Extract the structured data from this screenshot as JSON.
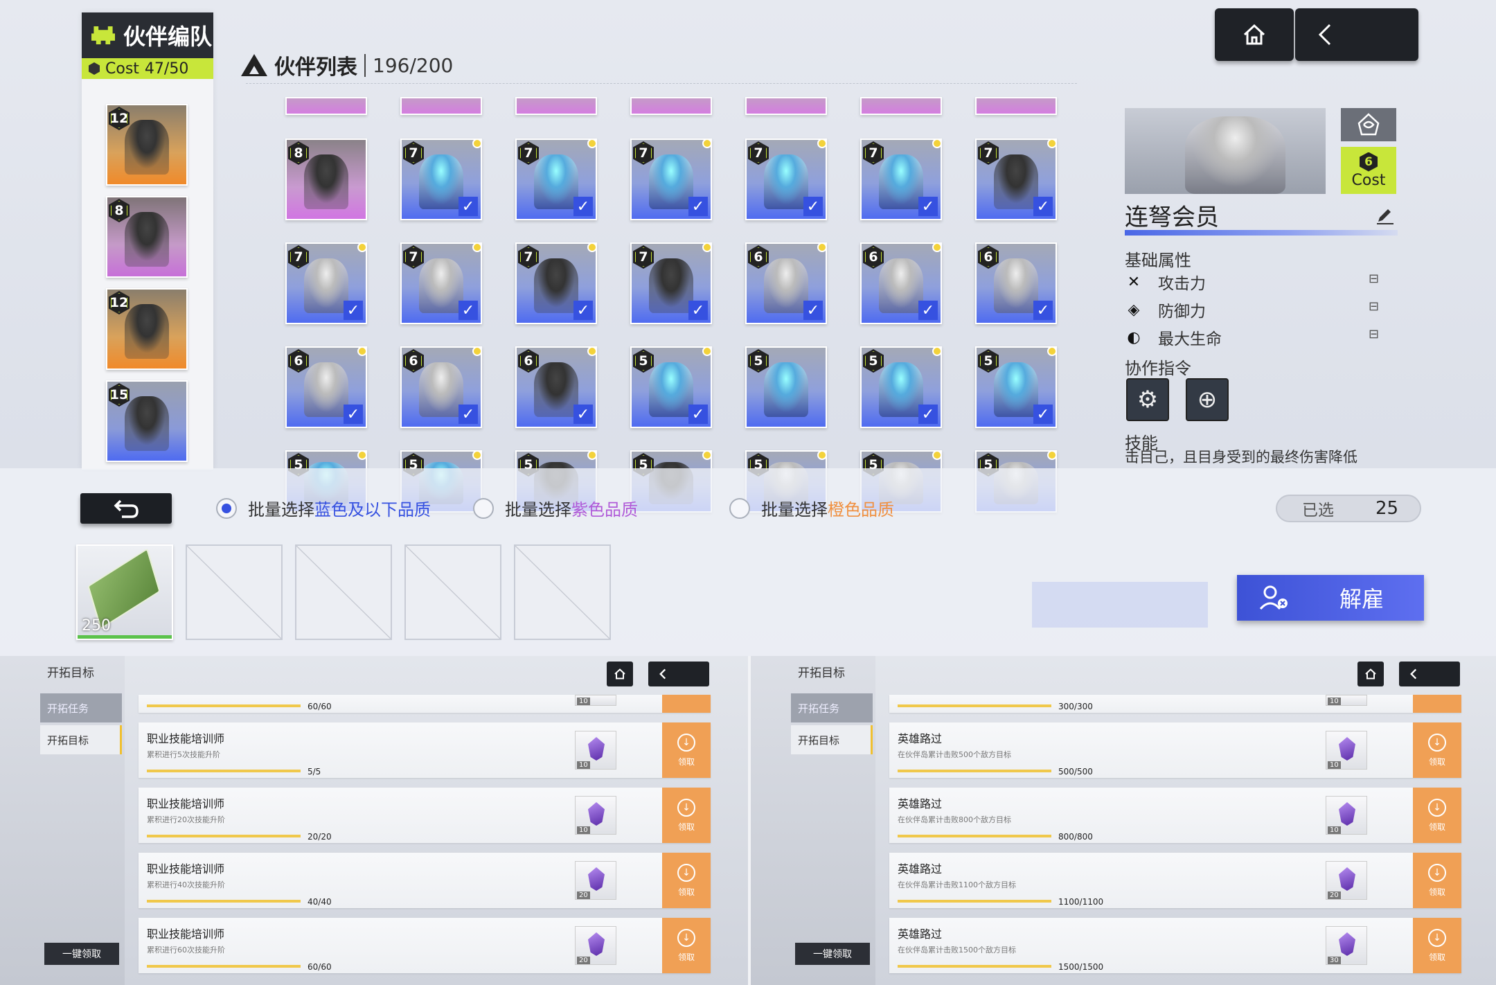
{
  "team": {
    "title": "伙伴编队",
    "cost_label": "Cost",
    "cost_value": "47/50",
    "slots": [
      {
        "level": "12",
        "rarity": "orange"
      },
      {
        "level": "8",
        "rarity": "purple"
      },
      {
        "level": "12",
        "rarity": "orange"
      },
      {
        "level": "15",
        "rarity": "blue"
      }
    ]
  },
  "list": {
    "title": "伙伴列表",
    "count": "196/200",
    "rows": [
      [
        {
          "level": "8",
          "rarity": "purple",
          "checked": false,
          "dot": false
        },
        {
          "level": "7",
          "rarity": "blue",
          "checked": true,
          "dot": true
        },
        {
          "level": "7",
          "rarity": "blue",
          "checked": true,
          "dot": true
        },
        {
          "level": "7",
          "rarity": "blue",
          "checked": true,
          "dot": true
        },
        {
          "level": "7",
          "rarity": "blue",
          "checked": true,
          "dot": true
        },
        {
          "level": "7",
          "rarity": "blue",
          "checked": true,
          "dot": true
        },
        {
          "level": "7",
          "rarity": "blue",
          "checked": true,
          "dot": true
        }
      ],
      [
        {
          "level": "7",
          "rarity": "blue",
          "checked": true,
          "dot": true
        },
        {
          "level": "7",
          "rarity": "blue",
          "checked": true,
          "dot": true
        },
        {
          "level": "7",
          "rarity": "blue",
          "checked": true,
          "dot": true
        },
        {
          "level": "7",
          "rarity": "blue",
          "checked": true,
          "dot": true
        },
        {
          "level": "6",
          "rarity": "blue",
          "checked": true,
          "dot": true
        },
        {
          "level": "6",
          "rarity": "blue",
          "checked": true,
          "dot": true
        },
        {
          "level": "6",
          "rarity": "blue",
          "checked": true,
          "dot": false
        }
      ],
      [
        {
          "level": "6",
          "rarity": "blue",
          "checked": true,
          "dot": true
        },
        {
          "level": "6",
          "rarity": "blue",
          "checked": true,
          "dot": true
        },
        {
          "level": "6",
          "rarity": "blue",
          "checked": true,
          "dot": true
        },
        {
          "level": "5",
          "rarity": "blue",
          "checked": true,
          "dot": true
        },
        {
          "level": "5",
          "rarity": "blue",
          "checked": false,
          "dot": false
        },
        {
          "level": "5",
          "rarity": "blue",
          "checked": true,
          "dot": true
        },
        {
          "level": "5",
          "rarity": "blue",
          "checked": true,
          "dot": true
        }
      ],
      [
        {
          "level": "5",
          "rarity": "blue",
          "checked": false,
          "dot": true
        },
        {
          "level": "5",
          "rarity": "blue",
          "checked": false,
          "dot": true
        },
        {
          "level": "5",
          "rarity": "blue",
          "checked": false,
          "dot": true
        },
        {
          "level": "5",
          "rarity": "blue",
          "checked": false,
          "dot": true
        },
        {
          "level": "5",
          "rarity": "blue",
          "checked": false,
          "dot": true
        },
        {
          "level": "5",
          "rarity": "blue",
          "checked": false,
          "dot": true
        },
        {
          "level": "5",
          "rarity": "blue",
          "checked": false,
          "dot": true
        }
      ]
    ]
  },
  "detail": {
    "name": "连弩会员",
    "cost_label": "Cost",
    "cost_value": "6",
    "basic_title": "基础属性",
    "attrs": [
      {
        "label": "攻击力",
        "icon": "swords-icon"
      },
      {
        "label": "防御力",
        "icon": "shield-icon"
      },
      {
        "label": "最大生命",
        "icon": "drop-icon"
      }
    ],
    "coop_title": "协作指令",
    "skill_title": "技能",
    "skill_text": "击目己，且目身受到的最终伤害降低"
  },
  "batch": {
    "blue": {
      "prefix": "批量选择",
      "highlight": "蓝色及以下品质",
      "color": "#3651e0"
    },
    "purple": {
      "prefix": "批量选择",
      "highlight": "紫色品质",
      "color": "#b05ad8"
    },
    "orange": {
      "prefix": "批量选择",
      "highlight": "橙色品质",
      "color": "#f09040"
    },
    "selected_label": "已选",
    "selected_count": "25"
  },
  "reward": {
    "qty": "250"
  },
  "dismiss_label": "解雇",
  "panels": [
    {
      "side_title": "开拓目标",
      "tab1": "开拓任务",
      "tab2": "开拓目标",
      "claim_all": "一键领取",
      "top_progress": "60/60",
      "top_num": "10",
      "rows": [
        {
          "title": "职业技能培训师",
          "desc": "累积进行5次技能升阶",
          "progress": "5/5",
          "num": "10",
          "claim": "领取"
        },
        {
          "title": "职业技能培训师",
          "desc": "累积进行20次技能升阶",
          "progress": "20/20",
          "num": "10",
          "claim": "领取"
        },
        {
          "title": "职业技能培训师",
          "desc": "累积进行40次技能升阶",
          "progress": "40/40",
          "num": "20",
          "claim": "领取"
        },
        {
          "title": "职业技能培训师",
          "desc": "累积进行60次技能升阶",
          "progress": "60/60",
          "num": "20",
          "claim": "领取"
        }
      ]
    },
    {
      "side_title": "开拓目标",
      "tab1": "开拓任务",
      "tab2": "开拓目标",
      "claim_all": "一键领取",
      "top_progress": "300/300",
      "top_num": "10",
      "rows": [
        {
          "title": "英雄路过",
          "desc": "在伙伴岛累计击败500个敌方目标",
          "progress": "500/500",
          "num": "10",
          "claim": "领取"
        },
        {
          "title": "英雄路过",
          "desc": "在伙伴岛累计击败800个敌方目标",
          "progress": "800/800",
          "num": "10",
          "claim": "领取"
        },
        {
          "title": "英雄路过",
          "desc": "在伙伴岛累计击败1100个敌方目标",
          "progress": "1100/1100",
          "num": "20",
          "claim": "领取"
        },
        {
          "title": "英雄路过",
          "desc": "在伙伴岛累计击败1500个敌方目标",
          "progress": "1500/1500",
          "num": "30",
          "claim": "领取"
        }
      ]
    }
  ]
}
